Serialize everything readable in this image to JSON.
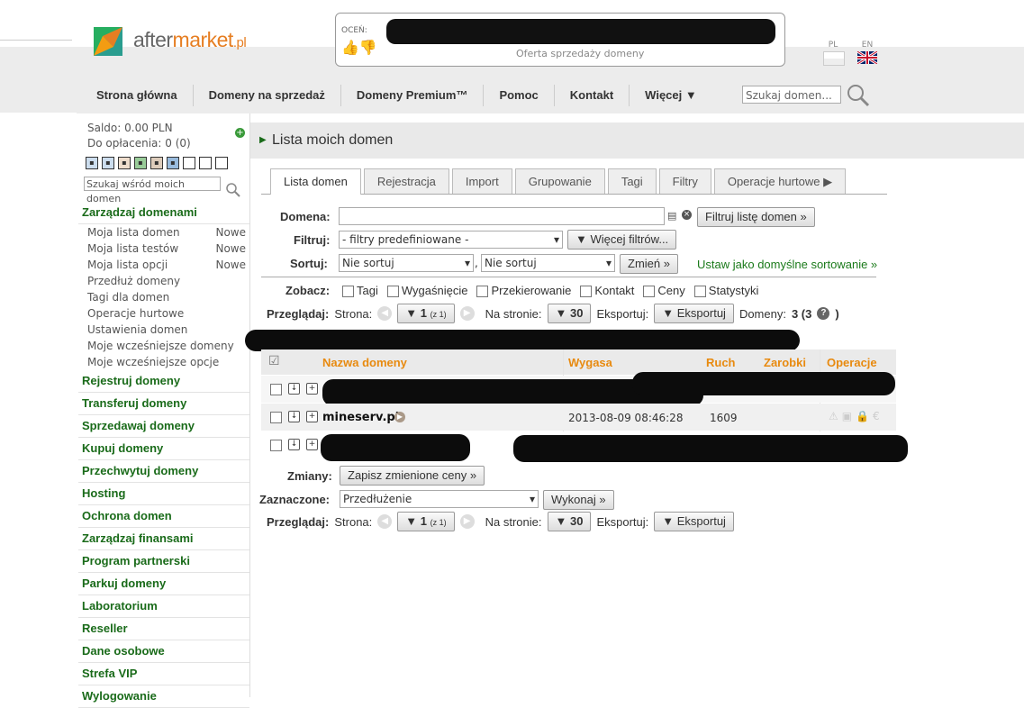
{
  "header": {
    "logo": {
      "part1": "after",
      "part2": "market",
      "part3": ".pl"
    },
    "rate_label": "OCEŃ:",
    "rate_sub": "Oferta sprzedaży domeny",
    "lang_pl": "PL",
    "lang_en": "EN",
    "search_placeholder": "Szukaj domen..."
  },
  "nav": [
    "Strona główna",
    "Domeny na sprzedaż",
    "Domeny Premium™",
    "Pomoc",
    "Kontakt",
    "Więcej ▼"
  ],
  "sidebar": {
    "saldo": "Saldo: 0.00 PLN",
    "do_oplacenia": "Do opłacenia: 0 (0)",
    "search_placeholder": "Szukaj wśród moich domen",
    "sections": [
      {
        "label": "Zarządzaj domenami",
        "items": [
          {
            "label": "Moja lista domen",
            "badge": "Nowe"
          },
          {
            "label": "Moja lista testów",
            "badge": "Nowe"
          },
          {
            "label": "Moja lista opcji",
            "badge": "Nowe"
          },
          {
            "label": "Przedłuż domeny",
            "badge": ""
          },
          {
            "label": "Tagi dla domen",
            "badge": ""
          },
          {
            "label": "Operacje hurtowe",
            "badge": ""
          },
          {
            "label": "Ustawienia domen",
            "badge": ""
          },
          {
            "label": "Moje wcześniejsze domeny",
            "badge": ""
          },
          {
            "label": "Moje wcześniejsze opcje",
            "badge": ""
          }
        ]
      },
      {
        "label": "Rejestruj domeny",
        "items": []
      },
      {
        "label": "Transferuj domeny",
        "items": []
      },
      {
        "label": "Sprzedawaj domeny",
        "items": []
      },
      {
        "label": "Kupuj domeny",
        "items": []
      },
      {
        "label": "Przechwytuj domeny",
        "items": []
      },
      {
        "label": "Hosting",
        "items": []
      },
      {
        "label": "Ochrona domen",
        "items": []
      },
      {
        "label": "Zarządzaj finansami",
        "items": []
      },
      {
        "label": "Program partnerski",
        "items": []
      },
      {
        "label": "Parkuj domeny",
        "items": []
      },
      {
        "label": "Laboratorium",
        "items": []
      },
      {
        "label": "Reseller",
        "items": []
      },
      {
        "label": "Dane osobowe",
        "items": []
      },
      {
        "label": "Strefa VIP",
        "items": []
      },
      {
        "label": "Wylogowanie",
        "items": []
      }
    ]
  },
  "main": {
    "title": "Lista moich domen",
    "tabs": [
      "Lista domen",
      "Rejestracja",
      "Import",
      "Grupowanie",
      "Tagi",
      "Filtry",
      "Operacje hurtowe ▶"
    ],
    "filters": {
      "domena_label": "Domena:",
      "filter_btn": "Filtruj listę domen »",
      "filtruj_label": "Filtruj:",
      "filtruj_value": "- filtry predefiniowane -",
      "more_filters": "▼ Więcej filtrów...",
      "sortuj_label": "Sortuj:",
      "sort1": "Nie sortuj",
      "sort2": "Nie sortuj",
      "change_btn": "Zmień »",
      "default_sort_link": "Ustaw jako domyślne sortowanie »"
    },
    "zobacz": {
      "label": "Zobacz:",
      "options": [
        "Tagi",
        "Wygaśnięcie",
        "Przekierowanie",
        "Kontakt",
        "Ceny",
        "Statystyki"
      ]
    },
    "paging": {
      "label": "Przeglądaj:",
      "strona": "Strona:",
      "page": "▼ 1",
      "of": "(z 1)",
      "na_stronie": "Na stronie:",
      "per_page": "▼ 30",
      "eksportuj_label": "Eksportuj:",
      "eksportuj_btn": "▼ Eksportuj",
      "domeny_label": "Domeny:",
      "domeny_count": "3 (3"
    },
    "table": {
      "headers": [
        "Nazwa domeny",
        "Wygasa",
        "Ruch",
        "Zarobki",
        "Operacje"
      ],
      "rows": [
        {
          "name": "",
          "expires": "",
          "traffic": ""
        },
        {
          "name": "mineserv.pl",
          "expires": "2013-08-09 08:46:28",
          "traffic": "1609"
        },
        {
          "name": "",
          "expires": "",
          "traffic": ""
        }
      ]
    },
    "bottom": {
      "zmiany_label": "Zmiany:",
      "save_prices": "Zapisz zmienione ceny »",
      "zaznaczone_label": "Zaznaczone:",
      "action_value": "Przedłużenie",
      "execute": "Wykonaj »"
    }
  }
}
